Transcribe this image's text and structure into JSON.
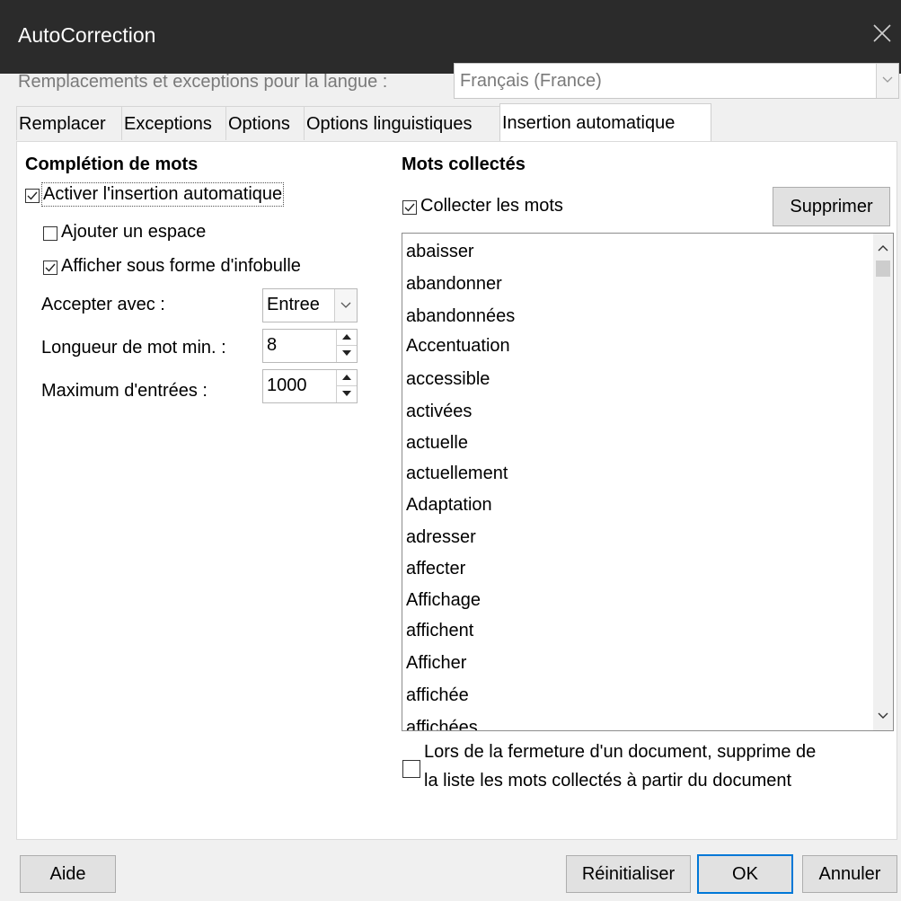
{
  "window": {
    "title": "AutoCorrection"
  },
  "language": {
    "label": "Remplacements et exceptions pour la langue :",
    "selected": "Français (France)"
  },
  "tabs": [
    {
      "label": "Remplacer"
    },
    {
      "label": "Exceptions"
    },
    {
      "label": "Options"
    },
    {
      "label": "Options linguistiques"
    },
    {
      "label": "Insertion automatique"
    }
  ],
  "active_tab": "Insertion automatique",
  "word_completion": {
    "heading": "Complétion de mots",
    "enable": {
      "label": "Activer l'insertion automatique",
      "checked": true
    },
    "add_space": {
      "label": "Ajouter un espace",
      "checked": false
    },
    "show_tooltip": {
      "label": "Afficher sous forme d'infobulle",
      "checked": true
    },
    "accept_with": {
      "label": "Accepter avec :",
      "value": "Entree"
    },
    "min_word_length": {
      "label": "Longueur de mot min. :",
      "value": "8"
    },
    "max_entries": {
      "label": "Maximum d'entrées :",
      "value": "1000"
    }
  },
  "collected_words": {
    "heading": "Mots collectés",
    "collect": {
      "label": "Collecter les mots",
      "checked": true
    },
    "delete_button": "Supprimer",
    "words": [
      "abaisser",
      "abandonner",
      "abandonnées",
      "Accentuation",
      "accessible",
      "activées",
      "actuelle",
      "actuellement",
      "Adaptation",
      "adresser",
      "affecter",
      "Affichage",
      "affichent",
      "Afficher",
      "affichée",
      "affichées"
    ],
    "remove_on_close": {
      "line1": "Lors de la fermeture d'un document, supprime de",
      "line2": "la liste les mots collectés à partir du document",
      "checked": false
    }
  },
  "buttons": {
    "help": "Aide",
    "reset": "Réinitialiser",
    "ok": "OK",
    "cancel": "Annuler"
  },
  "colors": {
    "titlebar": "#2b2b2b",
    "default_button_border": "#0078d7"
  },
  "icons": {
    "close": "close-icon",
    "dropdown": "chevron-down-icon",
    "check": "checkmark-icon"
  }
}
